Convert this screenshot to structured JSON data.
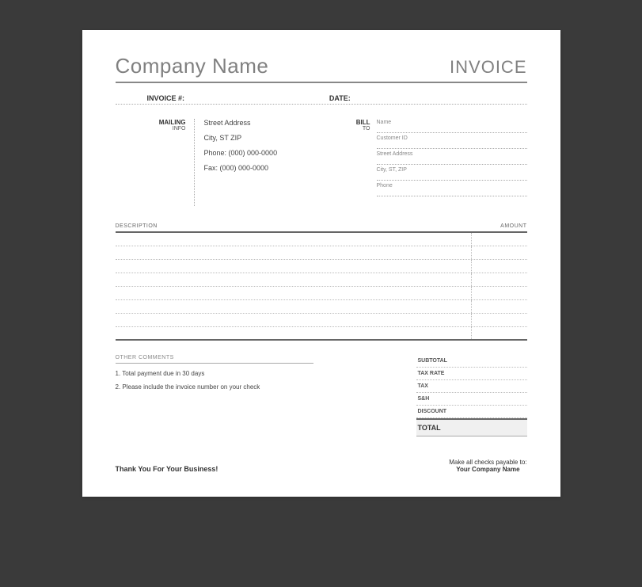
{
  "header": {
    "company_name": "Company Name",
    "invoice_title": "INVOICE"
  },
  "meta": {
    "invoice_label": "INVOICE #:",
    "date_label": "DATE:"
  },
  "mailing": {
    "label_main": "MAILING",
    "label_sub": "INFO",
    "address": "Street Address",
    "city": "City, ST  ZIP",
    "phone": "Phone: (000) 000-0000",
    "fax": "Fax: (000) 000-0000"
  },
  "billto": {
    "label_main": "BILL",
    "label_sub": "TO",
    "fields": {
      "name": "Name",
      "customer_id": "Customer ID",
      "address": "Street Address",
      "city": "City, ST, ZIP",
      "phone": "Phone"
    }
  },
  "table": {
    "col_description": "DESCRIPTION",
    "col_amount": "AMOUNT"
  },
  "comments": {
    "label": "OTHER COMMENTS",
    "line1": "1. Total payment due in 30 days",
    "line2": "2. Please include the invoice number on your check"
  },
  "totals": {
    "subtotal": "SUBTOTAL",
    "tax_rate": "TAX RATE",
    "tax": "TAX",
    "sh": "S&H",
    "discount": "DISCOUNT",
    "total": "TOTAL"
  },
  "footer": {
    "thanks": "Thank You For Your Business!",
    "payable_line": "Make all checks payable to:",
    "payable_name": "Your Company Name"
  }
}
